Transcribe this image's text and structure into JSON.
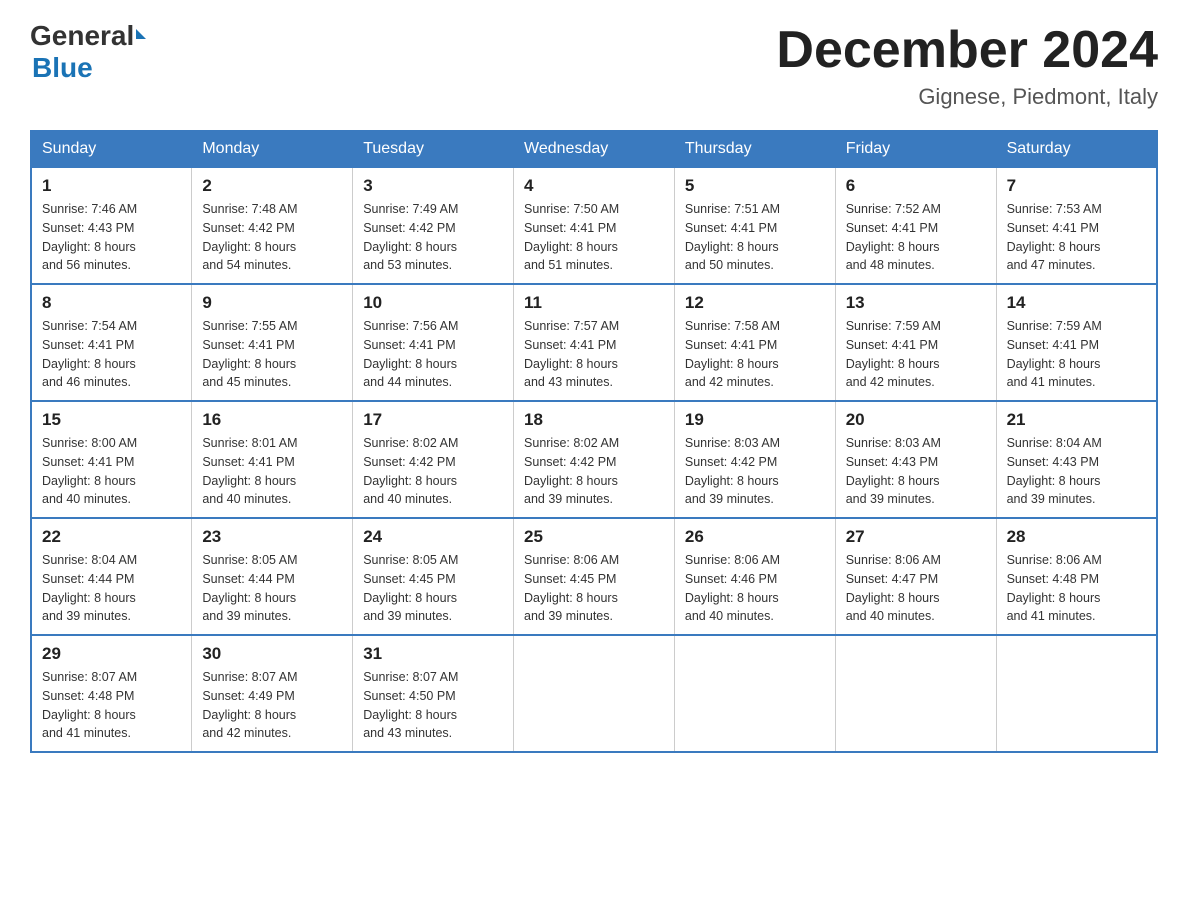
{
  "logo": {
    "part1": "General",
    "part2": "Blue"
  },
  "header": {
    "month_year": "December 2024",
    "location": "Gignese, Piedmont, Italy"
  },
  "days_of_week": [
    "Sunday",
    "Monday",
    "Tuesday",
    "Wednesday",
    "Thursday",
    "Friday",
    "Saturday"
  ],
  "weeks": [
    [
      {
        "day": "1",
        "sunrise": "Sunrise: 7:46 AM",
        "sunset": "Sunset: 4:43 PM",
        "daylight": "Daylight: 8 hours",
        "daylight2": "and 56 minutes."
      },
      {
        "day": "2",
        "sunrise": "Sunrise: 7:48 AM",
        "sunset": "Sunset: 4:42 PM",
        "daylight": "Daylight: 8 hours",
        "daylight2": "and 54 minutes."
      },
      {
        "day": "3",
        "sunrise": "Sunrise: 7:49 AM",
        "sunset": "Sunset: 4:42 PM",
        "daylight": "Daylight: 8 hours",
        "daylight2": "and 53 minutes."
      },
      {
        "day": "4",
        "sunrise": "Sunrise: 7:50 AM",
        "sunset": "Sunset: 4:41 PM",
        "daylight": "Daylight: 8 hours",
        "daylight2": "and 51 minutes."
      },
      {
        "day": "5",
        "sunrise": "Sunrise: 7:51 AM",
        "sunset": "Sunset: 4:41 PM",
        "daylight": "Daylight: 8 hours",
        "daylight2": "and 50 minutes."
      },
      {
        "day": "6",
        "sunrise": "Sunrise: 7:52 AM",
        "sunset": "Sunset: 4:41 PM",
        "daylight": "Daylight: 8 hours",
        "daylight2": "and 48 minutes."
      },
      {
        "day": "7",
        "sunrise": "Sunrise: 7:53 AM",
        "sunset": "Sunset: 4:41 PM",
        "daylight": "Daylight: 8 hours",
        "daylight2": "and 47 minutes."
      }
    ],
    [
      {
        "day": "8",
        "sunrise": "Sunrise: 7:54 AM",
        "sunset": "Sunset: 4:41 PM",
        "daylight": "Daylight: 8 hours",
        "daylight2": "and 46 minutes."
      },
      {
        "day": "9",
        "sunrise": "Sunrise: 7:55 AM",
        "sunset": "Sunset: 4:41 PM",
        "daylight": "Daylight: 8 hours",
        "daylight2": "and 45 minutes."
      },
      {
        "day": "10",
        "sunrise": "Sunrise: 7:56 AM",
        "sunset": "Sunset: 4:41 PM",
        "daylight": "Daylight: 8 hours",
        "daylight2": "and 44 minutes."
      },
      {
        "day": "11",
        "sunrise": "Sunrise: 7:57 AM",
        "sunset": "Sunset: 4:41 PM",
        "daylight": "Daylight: 8 hours",
        "daylight2": "and 43 minutes."
      },
      {
        "day": "12",
        "sunrise": "Sunrise: 7:58 AM",
        "sunset": "Sunset: 4:41 PM",
        "daylight": "Daylight: 8 hours",
        "daylight2": "and 42 minutes."
      },
      {
        "day": "13",
        "sunrise": "Sunrise: 7:59 AM",
        "sunset": "Sunset: 4:41 PM",
        "daylight": "Daylight: 8 hours",
        "daylight2": "and 42 minutes."
      },
      {
        "day": "14",
        "sunrise": "Sunrise: 7:59 AM",
        "sunset": "Sunset: 4:41 PM",
        "daylight": "Daylight: 8 hours",
        "daylight2": "and 41 minutes."
      }
    ],
    [
      {
        "day": "15",
        "sunrise": "Sunrise: 8:00 AM",
        "sunset": "Sunset: 4:41 PM",
        "daylight": "Daylight: 8 hours",
        "daylight2": "and 40 minutes."
      },
      {
        "day": "16",
        "sunrise": "Sunrise: 8:01 AM",
        "sunset": "Sunset: 4:41 PM",
        "daylight": "Daylight: 8 hours",
        "daylight2": "and 40 minutes."
      },
      {
        "day": "17",
        "sunrise": "Sunrise: 8:02 AM",
        "sunset": "Sunset: 4:42 PM",
        "daylight": "Daylight: 8 hours",
        "daylight2": "and 40 minutes."
      },
      {
        "day": "18",
        "sunrise": "Sunrise: 8:02 AM",
        "sunset": "Sunset: 4:42 PM",
        "daylight": "Daylight: 8 hours",
        "daylight2": "and 39 minutes."
      },
      {
        "day": "19",
        "sunrise": "Sunrise: 8:03 AM",
        "sunset": "Sunset: 4:42 PM",
        "daylight": "Daylight: 8 hours",
        "daylight2": "and 39 minutes."
      },
      {
        "day": "20",
        "sunrise": "Sunrise: 8:03 AM",
        "sunset": "Sunset: 4:43 PM",
        "daylight": "Daylight: 8 hours",
        "daylight2": "and 39 minutes."
      },
      {
        "day": "21",
        "sunrise": "Sunrise: 8:04 AM",
        "sunset": "Sunset: 4:43 PM",
        "daylight": "Daylight: 8 hours",
        "daylight2": "and 39 minutes."
      }
    ],
    [
      {
        "day": "22",
        "sunrise": "Sunrise: 8:04 AM",
        "sunset": "Sunset: 4:44 PM",
        "daylight": "Daylight: 8 hours",
        "daylight2": "and 39 minutes."
      },
      {
        "day": "23",
        "sunrise": "Sunrise: 8:05 AM",
        "sunset": "Sunset: 4:44 PM",
        "daylight": "Daylight: 8 hours",
        "daylight2": "and 39 minutes."
      },
      {
        "day": "24",
        "sunrise": "Sunrise: 8:05 AM",
        "sunset": "Sunset: 4:45 PM",
        "daylight": "Daylight: 8 hours",
        "daylight2": "and 39 minutes."
      },
      {
        "day": "25",
        "sunrise": "Sunrise: 8:06 AM",
        "sunset": "Sunset: 4:45 PM",
        "daylight": "Daylight: 8 hours",
        "daylight2": "and 39 minutes."
      },
      {
        "day": "26",
        "sunrise": "Sunrise: 8:06 AM",
        "sunset": "Sunset: 4:46 PM",
        "daylight": "Daylight: 8 hours",
        "daylight2": "and 40 minutes."
      },
      {
        "day": "27",
        "sunrise": "Sunrise: 8:06 AM",
        "sunset": "Sunset: 4:47 PM",
        "daylight": "Daylight: 8 hours",
        "daylight2": "and 40 minutes."
      },
      {
        "day": "28",
        "sunrise": "Sunrise: 8:06 AM",
        "sunset": "Sunset: 4:48 PM",
        "daylight": "Daylight: 8 hours",
        "daylight2": "and 41 minutes."
      }
    ],
    [
      {
        "day": "29",
        "sunrise": "Sunrise: 8:07 AM",
        "sunset": "Sunset: 4:48 PM",
        "daylight": "Daylight: 8 hours",
        "daylight2": "and 41 minutes."
      },
      {
        "day": "30",
        "sunrise": "Sunrise: 8:07 AM",
        "sunset": "Sunset: 4:49 PM",
        "daylight": "Daylight: 8 hours",
        "daylight2": "and 42 minutes."
      },
      {
        "day": "31",
        "sunrise": "Sunrise: 8:07 AM",
        "sunset": "Sunset: 4:50 PM",
        "daylight": "Daylight: 8 hours",
        "daylight2": "and 43 minutes."
      },
      null,
      null,
      null,
      null
    ]
  ]
}
